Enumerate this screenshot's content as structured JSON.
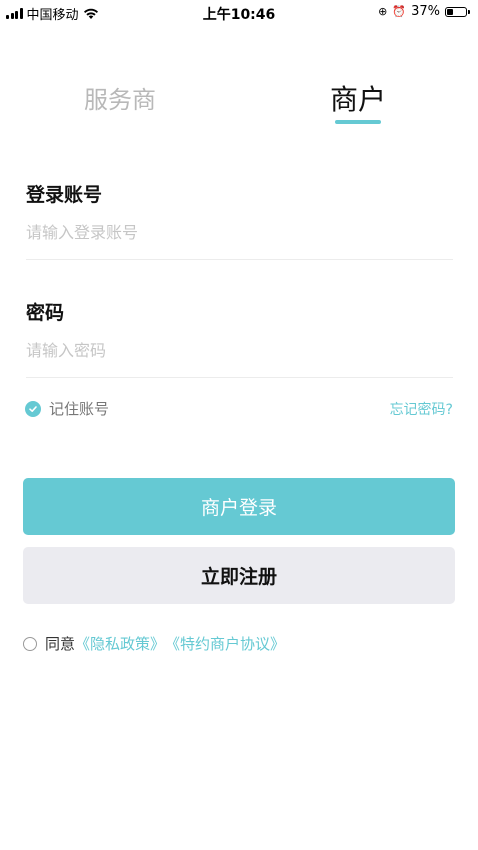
{
  "status_bar": {
    "carrier": "中国移动",
    "time": "上午10:46",
    "battery_percent": "37%",
    "battery_level": 0.37
  },
  "tabs": [
    {
      "label": "服务商",
      "active": false
    },
    {
      "label": "商户",
      "active": true
    }
  ],
  "form": {
    "account_label": "登录账号",
    "account_placeholder": "请输入登录账号",
    "account_value": "",
    "password_label": "密码",
    "password_placeholder": "请输入密码",
    "password_value": ""
  },
  "remember": {
    "label": "记住账号",
    "checked": true
  },
  "forgot_password": "忘记密码?",
  "buttons": {
    "login": "商户登录",
    "register": "立即注册"
  },
  "agreement": {
    "prefix": "同意",
    "privacy_link": "《隐私政策》",
    "merchant_link": "《特约商户协议》",
    "checked": false
  },
  "colors": {
    "accent": "#65c9d3",
    "register_bg": "#ebebf0",
    "inactive_tab": "#b8b8b8"
  }
}
